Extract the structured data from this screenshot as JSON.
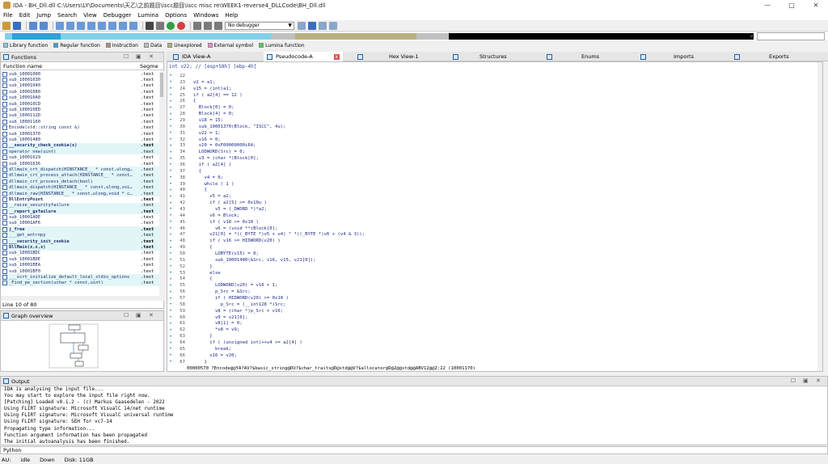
{
  "window": {
    "title": "IDA - BH_Dll.dll C:\\Users\\LY\\Documents\\天乙\\之前题目\\iscc题目\\iscc misc re\\WEEK1-reverse4_DLLCode\\BH_Dll.dll",
    "controls": [
      "—",
      "□",
      "✕"
    ]
  },
  "menu": [
    "File",
    "Edit",
    "Jump",
    "Search",
    "View",
    "Debugger",
    "Lumina",
    "Options",
    "Windows",
    "Help"
  ],
  "toolbar": {
    "debugger_select": "No debugger",
    "colors": {
      "save": "#3a6ec0",
      "open": "#c89a3a",
      "nav": "#5a8ad0",
      "hex": "#444444",
      "run": "#2ea043",
      "stop": "#d04040",
      "misc": "#7a7a7a"
    }
  },
  "legend": [
    {
      "label": "Library function",
      "color": "#7fd0e8"
    },
    {
      "label": "Regular function",
      "color": "#2fa0d8"
    },
    {
      "label": "Instruction",
      "color": "#b08a7a"
    },
    {
      "label": "Data",
      "color": "#c0c0c0"
    },
    {
      "label": "Unexplored",
      "color": "#b8b080"
    },
    {
      "label": "External symbol",
      "color": "#f08ac8"
    },
    {
      "label": "Lumina function",
      "color": "#50d050"
    }
  ],
  "functions_panel": {
    "title": "Functions",
    "col_name": "Function name",
    "col_segment": "Segme",
    "status": "Line 10 of 80",
    "rows": [
      {
        "name": "sub_10001000",
        "seg": ".text",
        "style": "normal"
      },
      {
        "name": "sub_10001030",
        "seg": ".text",
        "style": "normal"
      },
      {
        "name": "sub_10001040",
        "seg": ".text",
        "style": "normal"
      },
      {
        "name": "sub_10001080",
        "seg": ".text",
        "style": "normal"
      },
      {
        "name": "sub_100010A0",
        "seg": ".text",
        "style": "normal"
      },
      {
        "name": "sub_100010CD",
        "seg": ".text",
        "style": "normal"
      },
      {
        "name": "sub_100010ED",
        "seg": ".text",
        "style": "normal"
      },
      {
        "name": "sub_1000112D",
        "seg": ".text",
        "style": "normal"
      },
      {
        "name": "sub_10001160",
        "seg": ".text",
        "style": "normal"
      },
      {
        "name": "Encode(std::string const &)",
        "seg": ".text",
        "style": "selected"
      },
      {
        "name": "sub_10001370",
        "seg": ".text",
        "style": "normal"
      },
      {
        "name": "sub_10001480",
        "seg": ".text",
        "style": "normal"
      },
      {
        "name": "__security_check_cookie(x)",
        "seg": ".text",
        "style": "bold-hl"
      },
      {
        "name": "operator new(uint)",
        "seg": ".text",
        "style": "hl"
      },
      {
        "name": "sub_10001629",
        "seg": ".text",
        "style": "normal"
      },
      {
        "name": "sub_10001636",
        "seg": ".text",
        "style": "normal"
      },
      {
        "name": "dllmain_crt_dispatch(HINSTANCE__ * const,ulong…",
        "seg": ".text",
        "style": "hl"
      },
      {
        "name": "dllmain_crt_process_attach(HINSTANCE__ * const…",
        "seg": ".text",
        "style": "hl"
      },
      {
        "name": "dllmain_crt_process_detach(bool)",
        "seg": ".text",
        "style": "hl"
      },
      {
        "name": "dllmain_dispatch(HINSTANCE__ * const,ulong,voi…",
        "seg": ".text",
        "style": "hl"
      },
      {
        "name": "dllmain_raw(HINSTANCE__ * const,ulong,void * c…",
        "seg": ".text",
        "style": "hl"
      },
      {
        "name": "DllEntryPoint",
        "seg": ".text",
        "style": "bold"
      },
      {
        "name": "__raise_securityfailure",
        "seg": ".text",
        "style": "hl"
      },
      {
        "name": "__report_gsfailure",
        "seg": ".text",
        "style": "bold-hl"
      },
      {
        "name": "sub_10001ADE",
        "seg": ".text",
        "style": "normal"
      },
      {
        "name": "sub_10001AF6",
        "seg": ".text",
        "style": "normal"
      },
      {
        "name": "j_free",
        "seg": ".text",
        "style": "bold-hl"
      },
      {
        "name": "___get_entropy",
        "seg": ".text",
        "style": "hl"
      },
      {
        "name": "___security_init_cookie",
        "seg": ".text",
        "style": "bold-hl"
      },
      {
        "name": "DllMain(x,x,x)",
        "seg": ".text",
        "style": "bold-hl"
      },
      {
        "name": "sub_10001BDC",
        "seg": ".text",
        "style": "normal"
      },
      {
        "name": "sub_10001BDE",
        "seg": ".text",
        "style": "normal"
      },
      {
        "name": "sub_10001BEA",
        "seg": ".text",
        "style": "normal"
      },
      {
        "name": "sub_10001BF0",
        "seg": ".text",
        "style": "normal"
      },
      {
        "name": "___scrt_initialize_default_local_stdio_options",
        "seg": ".text",
        "style": "hl"
      },
      {
        "name": "_Find_pe_section(uchar * const,uint)",
        "seg": ".text",
        "style": "hl"
      }
    ]
  },
  "graph_overview": {
    "title": "Graph overview"
  },
  "tabs": [
    {
      "label": "IDA View-A",
      "active": false
    },
    {
      "label": "Pseudocode-A",
      "active": true,
      "closable": true
    },
    {
      "label": "Hex View-1",
      "active": false
    },
    {
      "label": "Structures",
      "active": false
    },
    {
      "label": "Enums",
      "active": false
    },
    {
      "label": "Imports",
      "active": false
    },
    {
      "label": "Exports",
      "active": false
    }
  ],
  "code": {
    "header": "int v22; // [esp+58h] [ebp-4h]",
    "status": "00000570 ?Encode@@YA?AV?$basic_string@DU?$char_traits@D@std@@V?$allocator@D@2@@std@@ABV12@@Z:22 (10001170)",
    "lines": [
      {
        "n": "22",
        "t": ""
      },
      {
        "n": "23",
        "t": "v2 = a1;"
      },
      {
        "n": "24",
        "t": "v15 = (int)a1;"
      },
      {
        "n": "25",
        "t": "if ( a2[4] == 12 )"
      },
      {
        "n": "26",
        "t": "{"
      },
      {
        "n": "27",
        "t": "  Block[0] = 0;"
      },
      {
        "n": "28",
        "t": "  Block[4] = 0;"
      },
      {
        "n": "29",
        "t": "  v18 = 15;"
      },
      {
        "n": "30",
        "t": "  sub_10001370(Block, \"ISCC\", 4u);"
      },
      {
        "n": "31",
        "t": "  v22 = 1;"
      },
      {
        "n": "32",
        "t": "  v16 = 0;"
      },
      {
        "n": "33",
        "t": "  v20 = 0xF00000000i64;"
      },
      {
        "n": "34",
        "t": "  LODWORD(Src) = 0;"
      },
      {
        "n": "35",
        "t": "  v3 = (char *)Block[0];"
      },
      {
        "n": "36",
        "t": "  if ( a2[4] )"
      },
      {
        "n": "37",
        "t": "  {"
      },
      {
        "n": "38",
        "t": "    v4 = 0;"
      },
      {
        "n": "39",
        "t": "    while ( 1 )"
      },
      {
        "n": "40",
        "t": "    {"
      },
      {
        "n": "41",
        "t": "      v5 = a2;"
      },
      {
        "n": "42",
        "t": "      if ( a2[5] >= 0x10u )"
      },
      {
        "n": "43",
        "t": "        v5 = (_DWORD *)*a2;"
      },
      {
        "n": "44",
        "t": "      v6 = Block;"
      },
      {
        "n": "45",
        "t": "      if ( v18 >= 0x10 )"
      },
      {
        "n": "46",
        "t": "        v6 = (void **)Block[0];"
      },
      {
        "n": "47",
        "t": "      v21[0] = *((_BYTE *)v5 + v4) ^ *((_BYTE *)v6 + (v4 & 3));"
      },
      {
        "n": "48",
        "t": "      if ( v16 >= HIDWORD(v20) )"
      },
      {
        "n": "49",
        "t": "      {"
      },
      {
        "n": "50",
        "t": "        LOBYTE(v15) = 0;"
      },
      {
        "n": "51",
        "t": "        sub_10001480(&Src, v16, v15, v21[0]);"
      },
      {
        "n": "52",
        "t": "      }"
      },
      {
        "n": "53",
        "t": "      else"
      },
      {
        "n": "54",
        "t": "      {"
      },
      {
        "n": "55",
        "t": "        LODWORD(v20) = v16 + 1;"
      },
      {
        "n": "56",
        "t": "        p_Src = &Src;"
      },
      {
        "n": "57",
        "t": "        if ( HIDWORD(v20) >= 0x10 )"
      },
      {
        "n": "58",
        "t": "          p_Src = (__int128 *)Src;"
      },
      {
        "n": "59",
        "t": "        v8 = (char *)p_Src + v16;"
      },
      {
        "n": "60",
        "t": "        v9 = v21[0];"
      },
      {
        "n": "61",
        "t": "        v8[1] = 0;"
      },
      {
        "n": "62",
        "t": "        *v8 = v9;"
      },
      {
        "n": "63",
        "t": "      }"
      },
      {
        "n": "64",
        "t": "      if ( (unsigned int)++v4 >= a2[4] )"
      },
      {
        "n": "65",
        "t": "        break;"
      },
      {
        "n": "66",
        "t": "      v16 = v20;"
      },
      {
        "n": "67",
        "t": "    }"
      }
    ]
  },
  "output": {
    "title": "Output",
    "lines": [
      "IDA is analysing the input file...",
      "You may start to explore the input file right now.",
      "[Patching] Loaded v0.1.2 - (c) Markus Gaasedelen - 2022",
      "Using FLIRT signature: Microsoft VisualC 14/net runtime",
      "Using FLIRT signature: Microsoft VisualC universal runtime",
      "Using FLIRT signature: SEH for vc7-14",
      "Propagating type information...",
      "Function argument information has been propagated",
      "The initial autoanalysis has been finished."
    ]
  },
  "python_label": "Python",
  "status": {
    "au": "AU:",
    "state": "idle",
    "direction": "Down",
    "disk": "Disk: 11GB"
  }
}
